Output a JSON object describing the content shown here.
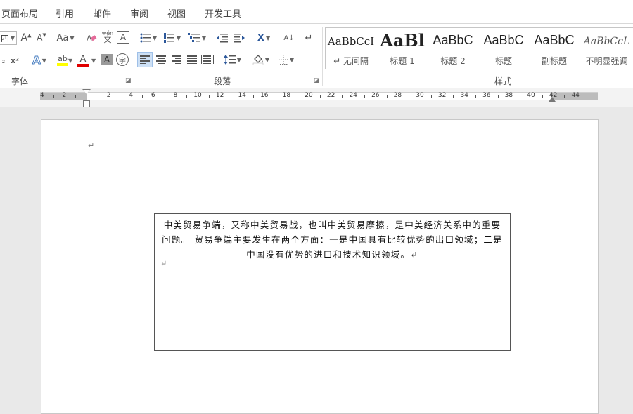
{
  "menu": {
    "tabs": [
      "页面布局",
      "引用",
      "邮件",
      "审阅",
      "视图",
      "开发工具"
    ]
  },
  "ribbon": {
    "font_group": {
      "label": "字体",
      "font_size_value": "四",
      "case_button": "Aa",
      "pinyin_top": "wén",
      "pinyin_bottom": "文",
      "border_char": "A",
      "subscript_label": "₂",
      "superscript_label": "x²",
      "highlight_char": "ab",
      "font_color_char": "A",
      "shading_char": "A",
      "enclose_char": "字",
      "grow_char": "A",
      "shrink_char": "A",
      "effects_char": "A"
    },
    "paragraph_group": {
      "label": "段落",
      "sort_label": "A↓",
      "chinese_layout": "X"
    },
    "styles_group": {
      "label": "样式",
      "items": [
        {
          "sample": "AaBbCcI",
          "name": "↵ 无间隔"
        },
        {
          "sample": "AaBl",
          "name": "标题 1"
        },
        {
          "sample": "AaBbC",
          "name": "标题 2"
        },
        {
          "sample": "AaBbC",
          "name": "标题"
        },
        {
          "sample": "AaBbC",
          "name": "副标题"
        },
        {
          "sample": "AaBbCcL",
          "name": "不明显强调"
        }
      ]
    },
    "colors": {
      "highlight": "#ffff00",
      "font_color": "#e00000",
      "accent": "#2b579a"
    }
  },
  "ruler": {
    "numbers": [
      "4",
      "2",
      "2",
      "4",
      "6",
      "8",
      "10",
      "12",
      "14",
      "16",
      "18",
      "20",
      "22",
      "24",
      "26",
      "28",
      "30",
      "32",
      "34",
      "36",
      "38",
      "40",
      "42",
      "44"
    ]
  },
  "document": {
    "paragraph_mark": "↵",
    "textbox_text": "中美贸易争端，又称中美贸易战，也叫中美贸易摩擦，是中美经济关系中的重要问题。 贸易争端主要发生在两个方面：一是中国具有比较优势的出口领域；二是中国没有优势的进口和技术知识领域。↵"
  }
}
